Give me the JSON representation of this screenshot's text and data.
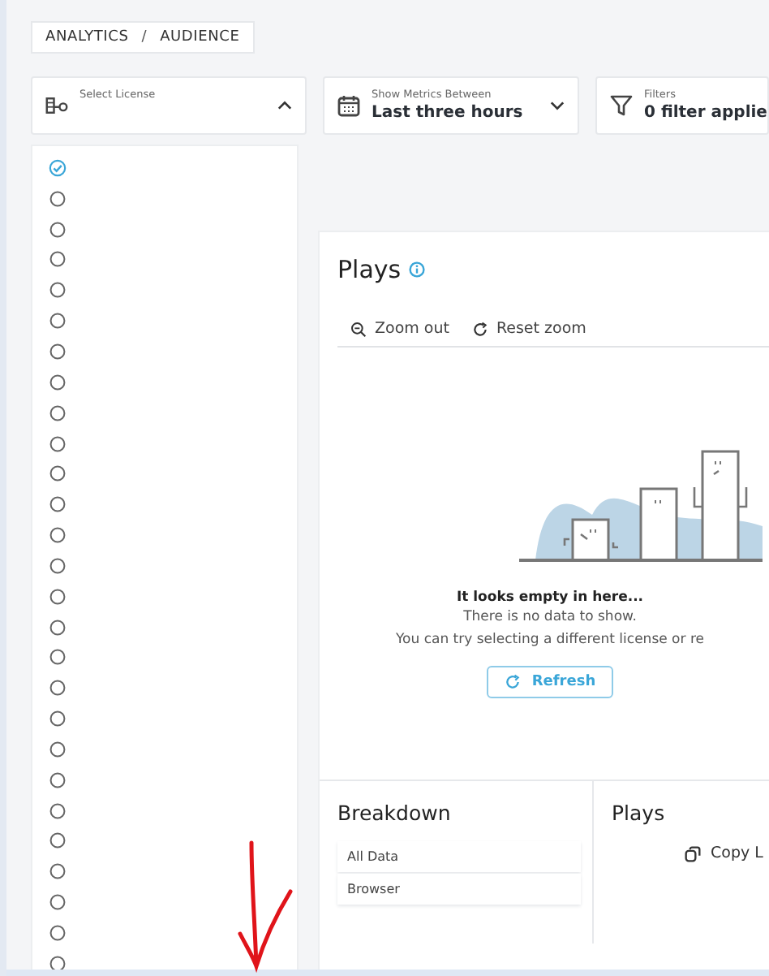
{
  "breadcrumb": [
    "ANALYTICS",
    "/",
    "AUDIENCE"
  ],
  "license_select": {
    "label": "Select License",
    "expanded": true
  },
  "metrics_select": {
    "label": "Show Metrics Between",
    "value": "Last three hours"
  },
  "filters": {
    "label": "Filters",
    "value": "0 filter applie"
  },
  "license_options": [
    {
      "selected": true
    },
    {
      "selected": false
    },
    {
      "selected": false
    },
    {
      "selected": false
    },
    {
      "selected": false
    },
    {
      "selected": false
    },
    {
      "selected": false
    },
    {
      "selected": false
    },
    {
      "selected": false
    },
    {
      "selected": false
    },
    {
      "selected": false
    },
    {
      "selected": false
    },
    {
      "selected": false
    },
    {
      "selected": false
    },
    {
      "selected": false
    },
    {
      "selected": false
    },
    {
      "selected": false
    },
    {
      "selected": false
    },
    {
      "selected": false
    },
    {
      "selected": false
    },
    {
      "selected": false
    },
    {
      "selected": false
    },
    {
      "selected": false
    },
    {
      "selected": false
    },
    {
      "selected": false
    },
    {
      "selected": false
    },
    {
      "selected": false
    }
  ],
  "plays_card": {
    "title": "Plays",
    "toolbar": [
      "Zoom out",
      "Reset zoom"
    ],
    "empty_title": "It looks empty in here...",
    "empty_lines": [
      "There is no data to show.",
      "You can try selecting a different license or re"
    ],
    "refresh": "Refresh"
  },
  "breakdown": {
    "title": "Breakdown",
    "items": [
      "All Data",
      "Browser"
    ]
  },
  "plays_panel": {
    "title": "Plays",
    "copy": "Copy L"
  }
}
